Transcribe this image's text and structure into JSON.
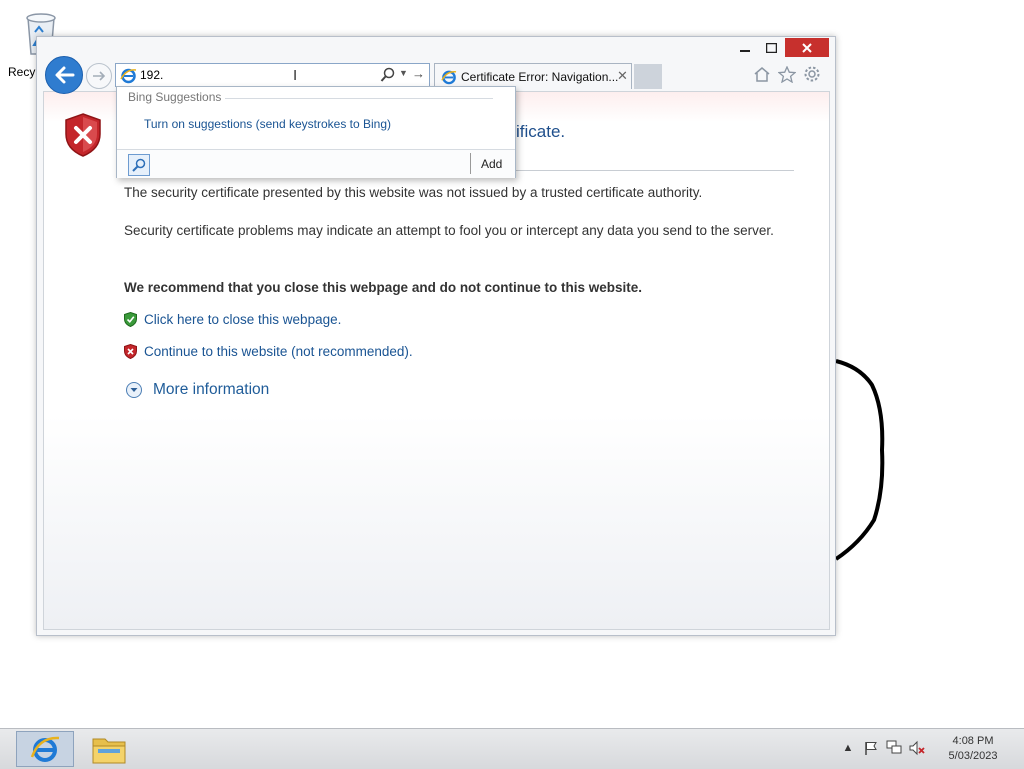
{
  "desktop": {
    "recycle_bin_label": "Recy"
  },
  "browser": {
    "address": {
      "value": "192."
    },
    "tab": {
      "title": "Certificate Error: Navigation..."
    },
    "page": {
      "heading_partial": "ificate.",
      "para1": "The security certificate presented by this website was not issued by a trusted certificate authority.",
      "para2": "Security certificate problems may indicate an attempt to fool you or intercept any data you send to the server.",
      "recommend": "We recommend that you close this webpage and do not continue to this website.",
      "close_link": "Click here to close this webpage.",
      "continue_link": "Continue to this website (not recommended).",
      "more_info": "More information"
    },
    "suggestions": {
      "header": "Bing Suggestions",
      "turn_on": "Turn on suggestions (send keystrokes to Bing)",
      "add": "Add"
    }
  },
  "taskbar": {
    "time": "4:08 PM",
    "date": "5/03/2023"
  },
  "colors": {
    "accent": "#2f7ccf",
    "close_button": "#c7302d",
    "link": "#1a5493",
    "error_red": "#c4262b",
    "safe_green": "#3a9a3a"
  },
  "icons": [
    "recycle-bin-icon",
    "back-icon",
    "forward-icon",
    "ie-icon",
    "search-icon",
    "dropdown-icon",
    "go-icon",
    "tab-close-icon",
    "home-icon",
    "favorites-icon",
    "tools-gear-icon",
    "shield-error-icon",
    "shield-ok-icon",
    "expand-icon",
    "file-explorer-icon",
    "flag-icon",
    "network-icon",
    "volume-muted-icon",
    "tray-overflow-icon"
  ]
}
